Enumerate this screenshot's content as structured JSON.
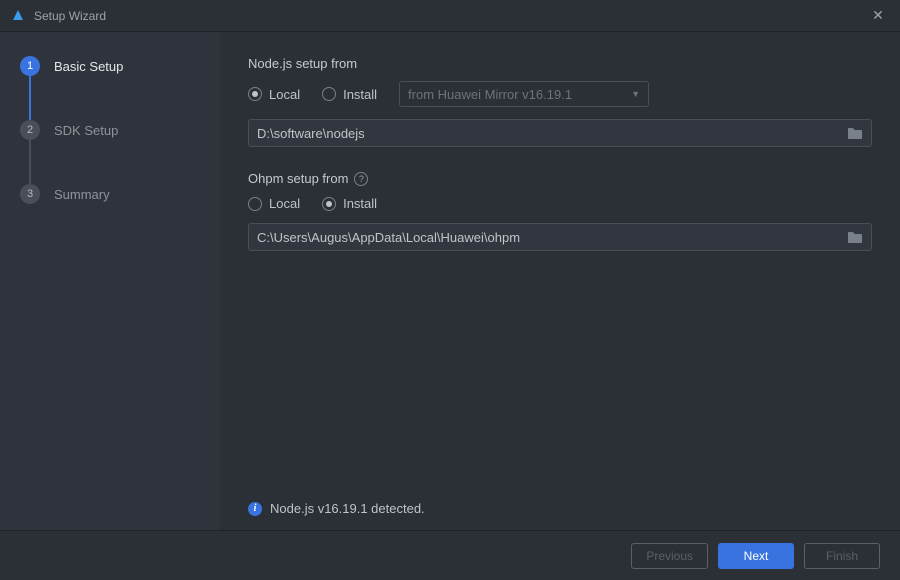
{
  "window": {
    "title": "Setup Wizard"
  },
  "sidebar": {
    "steps": [
      {
        "num": "1",
        "label": "Basic Setup",
        "active": true
      },
      {
        "num": "2",
        "label": "SDK Setup",
        "active": false
      },
      {
        "num": "3",
        "label": "Summary",
        "active": false
      }
    ]
  },
  "nodejs": {
    "section_label": "Node.js setup from",
    "radio_local": "Local",
    "radio_install": "Install",
    "selected": "local",
    "mirror_dropdown": "from Huawei Mirror v16.19.1",
    "path": "D:\\software\\nodejs"
  },
  "ohpm": {
    "section_label": "Ohpm setup from",
    "radio_local": "Local",
    "radio_install": "Install",
    "selected": "install",
    "path": "C:\\Users\\Augus\\AppData\\Local\\Huawei\\ohpm"
  },
  "status": {
    "message": "Node.js v16.19.1 detected."
  },
  "footer": {
    "previous": "Previous",
    "next": "Next",
    "finish": "Finish"
  }
}
